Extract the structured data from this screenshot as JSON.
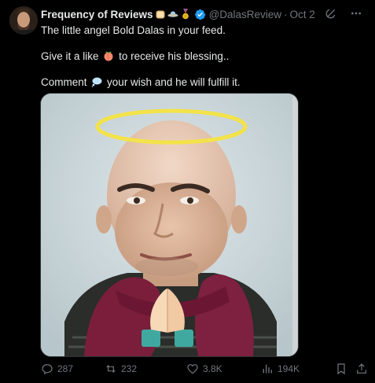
{
  "post": {
    "author_name": "Frequency of Reviews",
    "handle": "@DalasReview",
    "separator": "·",
    "date": "Oct 2",
    "line1": "The little angel Bold Dalas in your feed.",
    "line2_before": "Give it a like",
    "line2_after": "to receive his blessing..",
    "line3_before": "Comment",
    "line3_after": "your wish and he will fulfill it."
  },
  "icons": {
    "name_badges": [
      "toast-icon",
      "ufo-icon",
      "medal-icon"
    ],
    "verified": "verified-badge-icon",
    "like_inline": "peach-icon",
    "comment_inline": "speech-bubble-icon"
  },
  "actions": {
    "replies": "287",
    "reposts": "232",
    "likes": "3.8K",
    "views": "194K"
  },
  "colors": {
    "background": "#000000",
    "text": "#e7e9ea",
    "muted": "#71767b",
    "verified": "#1d9bf0",
    "halo": "#f3e34a"
  }
}
